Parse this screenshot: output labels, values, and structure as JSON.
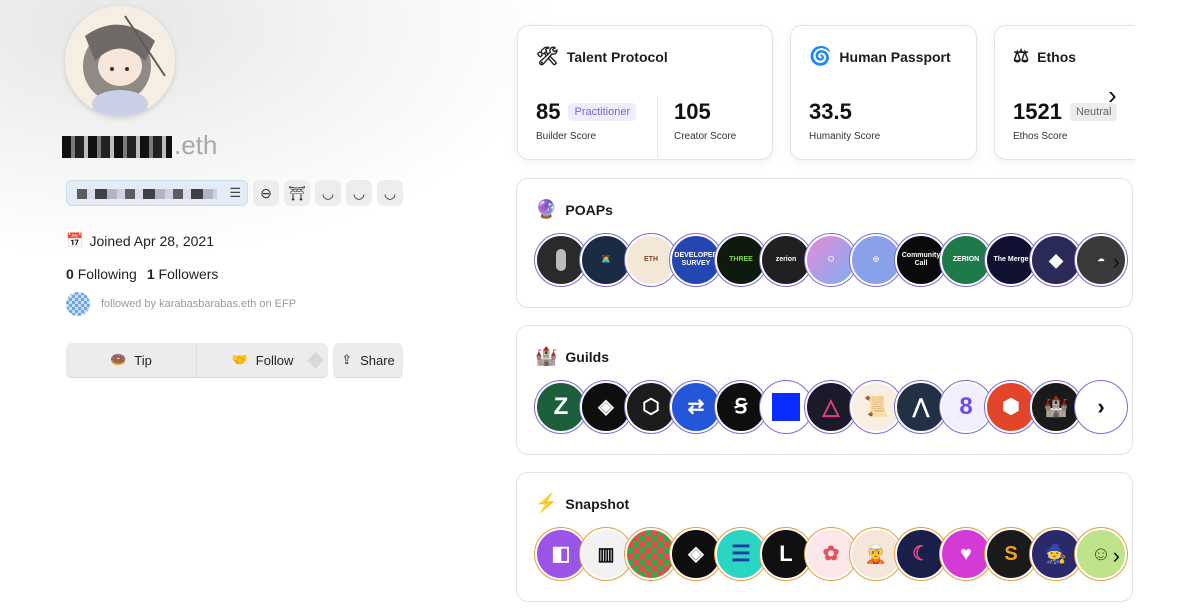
{
  "profile": {
    "name_suffix": ".eth",
    "joined": "Joined Apr 28, 2021",
    "following_count": "0",
    "following_label": "Following",
    "followers_count": "1",
    "followers_label": "Followers",
    "followed_by": "followed by karabasbarabas.eth on EFP",
    "actions": {
      "tip": "Tip",
      "follow": "Follow",
      "share": "Share"
    }
  },
  "scores": [
    {
      "name": "Talent Protocol",
      "icon": "hammer-wrench-icon",
      "items": [
        {
          "value": "85",
          "tag": "Practitioner",
          "label": "Builder Score"
        },
        {
          "value": "105",
          "label": "Creator Score"
        }
      ]
    },
    {
      "name": "Human Passport",
      "icon": "spiral-icon",
      "items": [
        {
          "value": "33.5",
          "label": "Humanity Score"
        }
      ]
    },
    {
      "name": "Ethos",
      "icon": "scales-icon",
      "items": [
        {
          "value": "1521",
          "tag": "Neutral",
          "label": "Ethos Score"
        }
      ]
    }
  ],
  "sections": {
    "poaps": {
      "title": "POAPs",
      "icon": "crystal-ball-icon"
    },
    "guilds": {
      "title": "Guilds",
      "icon": "castle-icon"
    },
    "snapshot": {
      "title": "Snapshot",
      "icon": "lightning-icon"
    }
  },
  "colors": {
    "accent_purple": "#7a64d8",
    "snapshot_ring": "#e69b3b",
    "poap_ring": "#7a6ad6"
  },
  "badge_texts": {
    "poap_3": "DEVELOPER SURVEY",
    "poap_4": "THREE",
    "poap_5": "zerion",
    "poap_8": "Community Call",
    "poap_9": "ZERION",
    "poap_10": "The Merge"
  }
}
